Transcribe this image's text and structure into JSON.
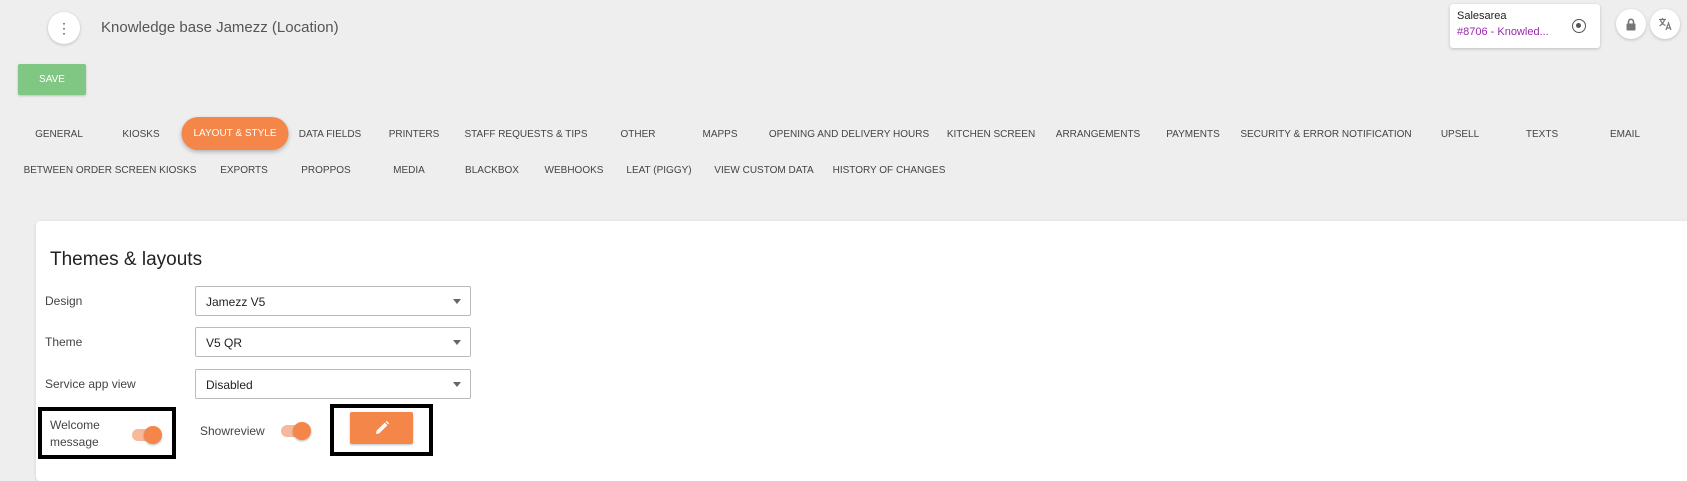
{
  "header": {
    "menu_icon": "more-vert-icon",
    "title": "Knowledge base Jamezz (Location)",
    "salesarea": {
      "label": "Salesarea",
      "value": "#8706 - Knowled..."
    },
    "icons": [
      "target-icon",
      "lock-icon",
      "translate-icon"
    ]
  },
  "toolbar": {
    "save_label": "SAVE"
  },
  "tabs": {
    "row1": [
      "GENERAL",
      "KIOSKS",
      "LAYOUT & STYLE",
      "DATA FIELDS",
      "PRINTERS",
      "STAFF REQUESTS & TIPS",
      "OTHER",
      "MAPPS",
      "OPENING AND DELIVERY HOURS",
      "KITCHEN SCREEN",
      "ARRANGEMENTS",
      "PAYMENTS",
      "SECURITY & ERROR NOTIFICATION",
      "UPSELL",
      "TEXTS",
      "EMAIL"
    ],
    "row2": [
      "BETWEEN ORDER SCREEN KIOSKS",
      "EXPORTS",
      "PROPPOS",
      "MEDIA",
      "BLACKBOX",
      "WEBHOOKS",
      "LEAT (PIGGY)",
      "VIEW CUSTOM DATA",
      "HISTORY OF CHANGES"
    ],
    "active": "LAYOUT & STYLE"
  },
  "themes": {
    "title": "Themes & layouts",
    "design": {
      "label": "Design",
      "value": "Jamezz V5"
    },
    "theme": {
      "label": "Theme",
      "value": "V5 QR"
    },
    "service_app_view": {
      "label": "Service app view",
      "value": "Disabled"
    },
    "welcome_message": {
      "label_line1": "Welcome",
      "label_line2": "message",
      "enabled": true
    },
    "showreview": {
      "label": "Showreview",
      "enabled": true
    },
    "edit_icon": "pencil-icon"
  },
  "colors": {
    "accent": "#f4864a",
    "save": "#81c784",
    "salesarea_value": "#9c27b0"
  }
}
